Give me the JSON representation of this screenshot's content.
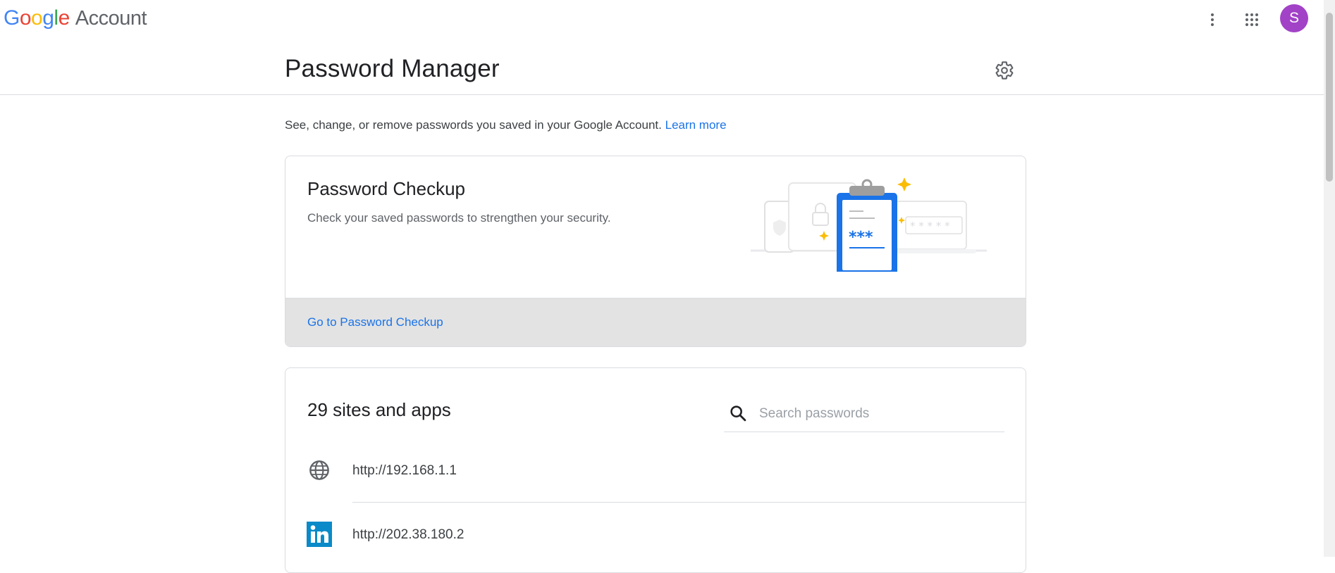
{
  "header": {
    "logo_letters": [
      "G",
      "o",
      "o",
      "g",
      "l",
      "e"
    ],
    "logo_suffix": "Account",
    "more_icon": "more-vert-icon",
    "apps_icon": "apps-grid-icon",
    "avatar_letter": "S",
    "avatar_color": "#a142c7"
  },
  "page": {
    "title": "Password Manager",
    "settings_icon": "gear-icon",
    "description": "See, change, or remove passwords you saved in your Google Account.",
    "learn_more": "Learn more"
  },
  "checkup": {
    "title": "Password Checkup",
    "subtitle": "Check your saved passwords to strengthen your security.",
    "link": "Go to Password Checkup",
    "illustration_mask": "***"
  },
  "sites": {
    "count_label": "29 sites and apps",
    "search_placeholder": "Search passwords",
    "items": [
      {
        "url": "http://192.168.1.1",
        "icon": "globe-icon"
      },
      {
        "url": "http://202.38.180.2",
        "icon": "linkedin-icon"
      }
    ]
  },
  "colors": {
    "accent": "#1a73e8",
    "footer_bg": "#e3e3e3",
    "clipboard_blue": "#1a73e8",
    "sparkle": "#fbbc05"
  }
}
